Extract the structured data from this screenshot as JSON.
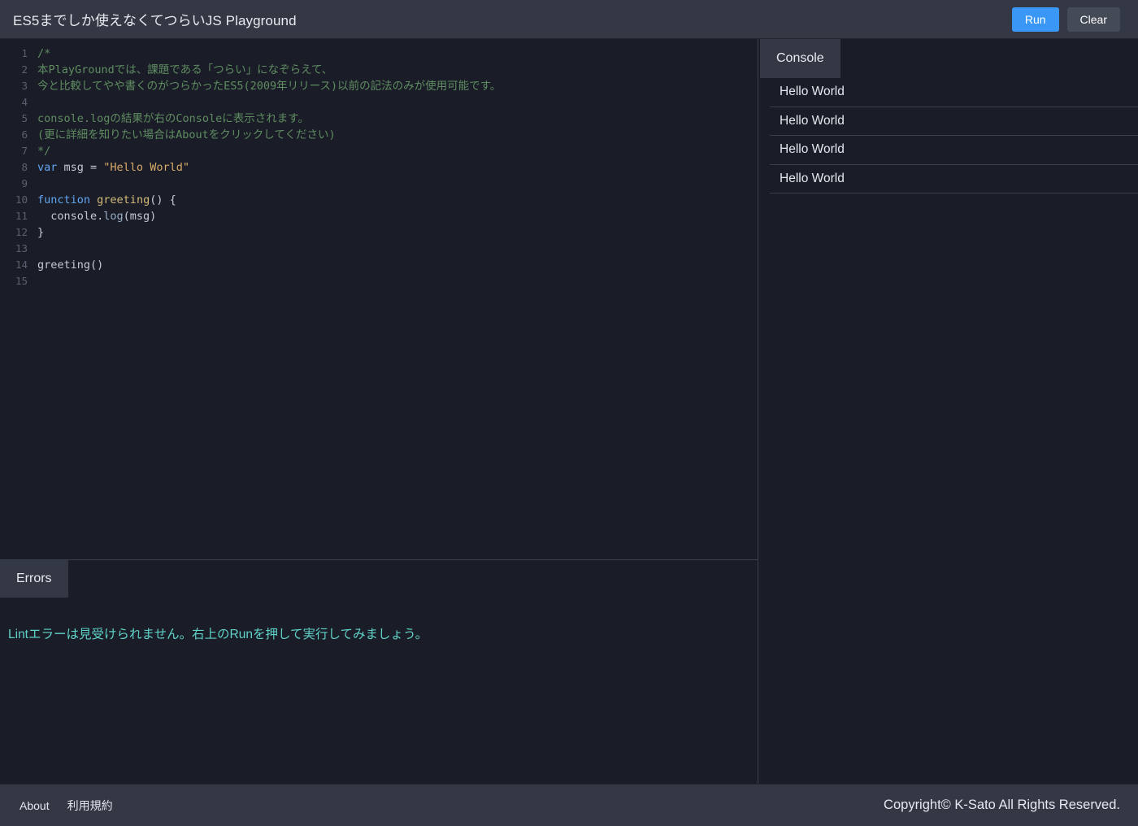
{
  "header": {
    "title": "ES5までしか使えなくてつらいJS Playground",
    "run_label": "Run",
    "clear_label": "Clear",
    "accent_color": "#3b97f6",
    "bg_color": "#343844"
  },
  "editor": {
    "language": "javascript",
    "line_count": 15,
    "lines": [
      {
        "n": "1",
        "tokens": [
          {
            "t": "/*",
            "c": "tk-comment"
          }
        ]
      },
      {
        "n": "2",
        "tokens": [
          {
            "t": "本PlayGroundでは、課題である「つらい」になぞらえて、",
            "c": "tk-comment"
          }
        ]
      },
      {
        "n": "3",
        "tokens": [
          {
            "t": "今と比較してやや書くのがつらかったES5(2009年リリース)以前の記法のみが使用可能です。",
            "c": "tk-comment"
          }
        ]
      },
      {
        "n": "4",
        "tokens": []
      },
      {
        "n": "5",
        "tokens": [
          {
            "t": "console.logの結果が右のConsoleに表示されます。",
            "c": "tk-comment"
          }
        ]
      },
      {
        "n": "6",
        "tokens": [
          {
            "t": "(更に詳細を知りたい場合はAboutをクリックしてください)",
            "c": "tk-comment"
          }
        ]
      },
      {
        "n": "7",
        "tokens": [
          {
            "t": "*/",
            "c": "tk-comment"
          }
        ]
      },
      {
        "n": "8",
        "tokens": [
          {
            "t": "var",
            "c": "tk-keyword"
          },
          {
            "t": " msg = ",
            "c": "tk-plain"
          },
          {
            "t": "\"Hello World\"",
            "c": "tk-string"
          }
        ]
      },
      {
        "n": "9",
        "tokens": []
      },
      {
        "n": "10",
        "tokens": [
          {
            "t": "function",
            "c": "tk-keyword"
          },
          {
            "t": " ",
            "c": "tk-plain"
          },
          {
            "t": "greeting",
            "c": "tk-func"
          },
          {
            "t": "() {",
            "c": "tk-punct"
          }
        ]
      },
      {
        "n": "11",
        "tokens": [
          {
            "t": "  console.",
            "c": "tk-plain"
          },
          {
            "t": "log",
            "c": "tk-prop"
          },
          {
            "t": "(msg)",
            "c": "tk-plain"
          }
        ]
      },
      {
        "n": "12",
        "tokens": [
          {
            "t": "}",
            "c": "tk-punct"
          }
        ]
      },
      {
        "n": "13",
        "tokens": []
      },
      {
        "n": "14",
        "tokens": [
          {
            "t": "greeting()",
            "c": "tk-plain"
          }
        ]
      },
      {
        "n": "15",
        "tokens": []
      }
    ]
  },
  "console_panel": {
    "tab_label": "Console",
    "entries": [
      "Hello World",
      "Hello World",
      "Hello World",
      "Hello World"
    ]
  },
  "errors_panel": {
    "tab_label": "Errors",
    "message": "Lintエラーは見受けられません。右上のRunを押して実行してみましょう。",
    "message_color": "#5fd2c8"
  },
  "footer": {
    "links": [
      {
        "label": "About"
      },
      {
        "label": "利用規約"
      }
    ],
    "copyright": "Copyright© K-Sato All Rights Reserved."
  }
}
